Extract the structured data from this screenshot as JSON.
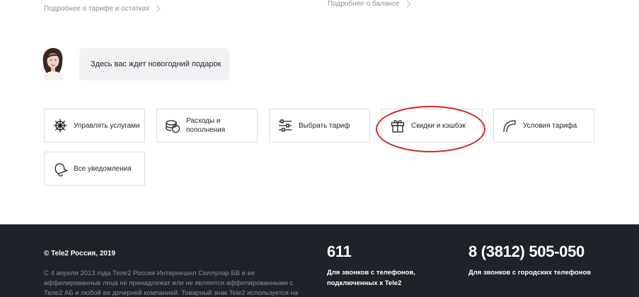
{
  "links": {
    "tariff_details": "Подробнее о тарифе и остатках",
    "balance_details": "Подробнее о балансе"
  },
  "assistant": {
    "message": "Здесь вас ждет новогодний подарок"
  },
  "tiles": [
    {
      "label": "Управлять услугами",
      "icon": "helm-icon"
    },
    {
      "label": "Расходы и пополнения",
      "icon": "coins-icon"
    },
    {
      "label": "Выбрать тариф",
      "icon": "sliders-icon"
    },
    {
      "label": "Скидки и кэшбэк",
      "icon": "gift-icon"
    },
    {
      "label": "Условия тарифа",
      "icon": "curve-icon"
    },
    {
      "label": "Все уведомления",
      "icon": "bell-icon"
    }
  ],
  "highlight_color": "#d2262b",
  "footer": {
    "copyright": "© Tele2 Россия, 2019",
    "legal": "С 4 апреля 2013 года Теле2 Россия Интернешнл Селлулар БВ и ее аффилированные лица не принадлежат или не являются аффилированными с Теле2 АБ и любой ее дочерней компанией. Товарный знак Tele2 используется на основании лицензии от",
    "phone_short": "611",
    "phone_short_desc_line1": "Для звонков с телефонов,",
    "phone_short_desc_line2": "подключенных к Tele2",
    "phone_city": "8 (3812) 505-050",
    "phone_city_desc": "Для звонков с городских телефонов",
    "background": "#1f2229"
  }
}
